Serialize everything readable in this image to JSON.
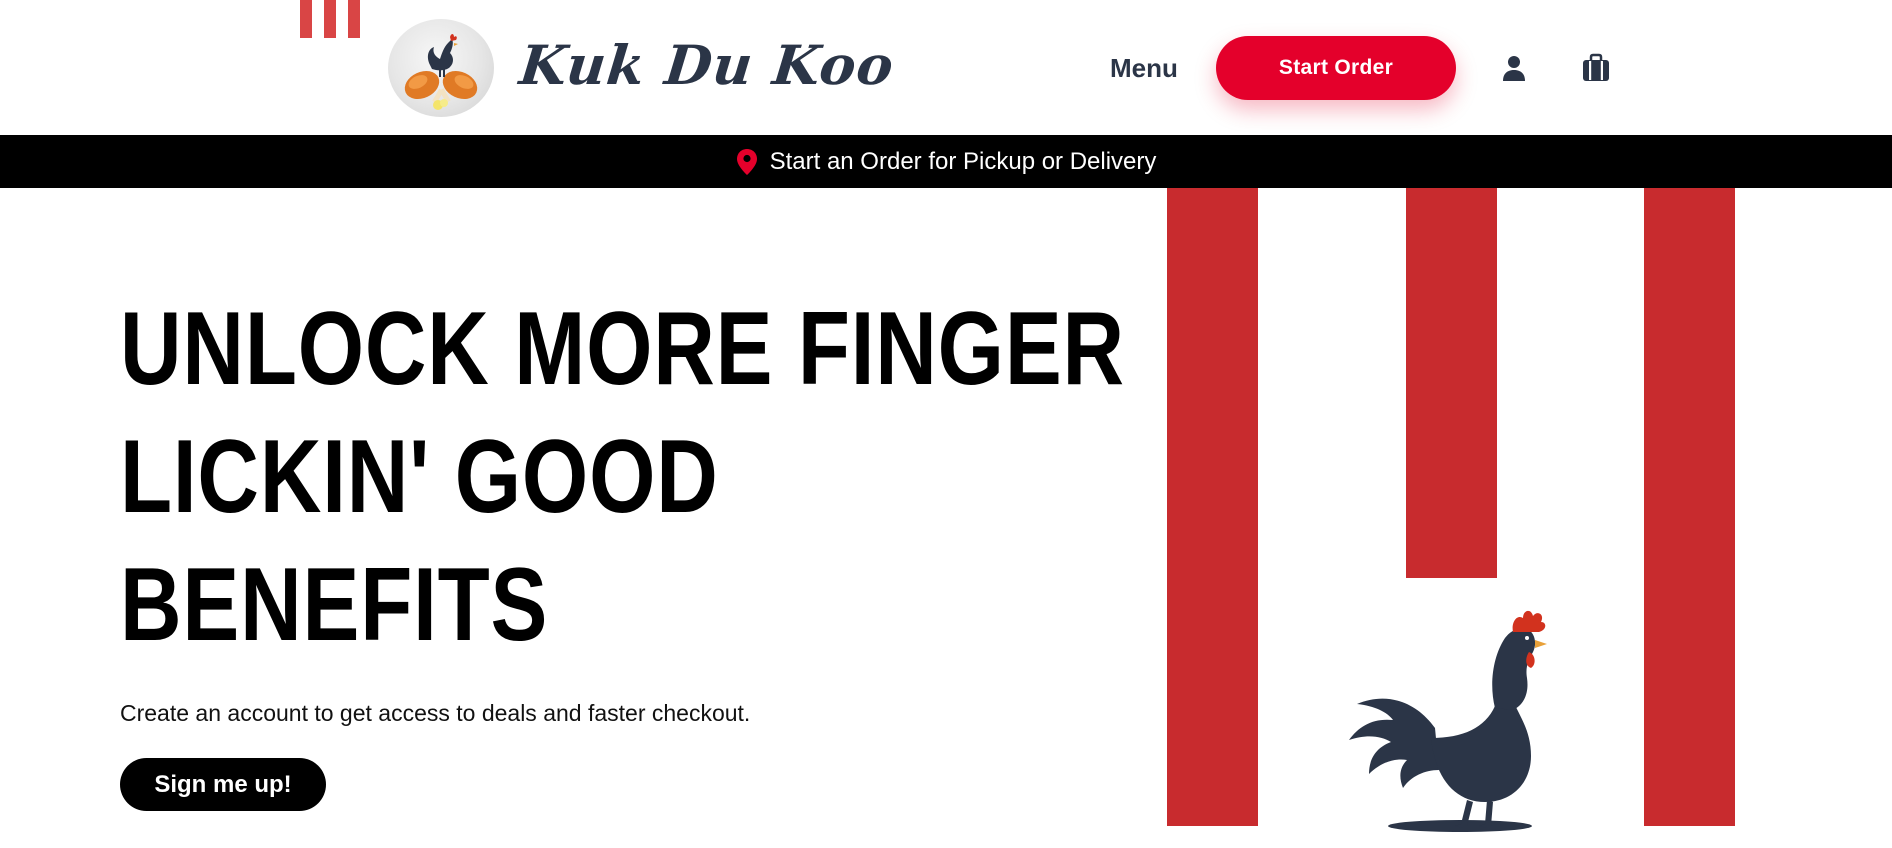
{
  "header": {
    "brand_name": "Kuk Du Koo",
    "logo_icon": "rooster-drumsticks-logo",
    "nav": {
      "menu_label": "Menu"
    },
    "start_order_label": "Start Order",
    "account_icon": "user-icon",
    "bag_icon": "shopping-bag-icon"
  },
  "banner": {
    "icon": "location-pin-icon",
    "text": "Start an Order for Pickup or Delivery"
  },
  "hero": {
    "title_lines": [
      "UNLOCK MORE FINGER",
      "LICKIN' GOOD",
      "BENEFITS"
    ],
    "subtitle": "Create an account to get access to deals and faster checkout.",
    "cta_label": "Sign me up!",
    "art_icon": "rooster-illustration"
  },
  "colors": {
    "brand_red": "#e4002b",
    "stripe_red": "#c82b2e",
    "navy": "#2b3547",
    "banner_bg": "#000000",
    "pin_red": "#e4002b"
  }
}
